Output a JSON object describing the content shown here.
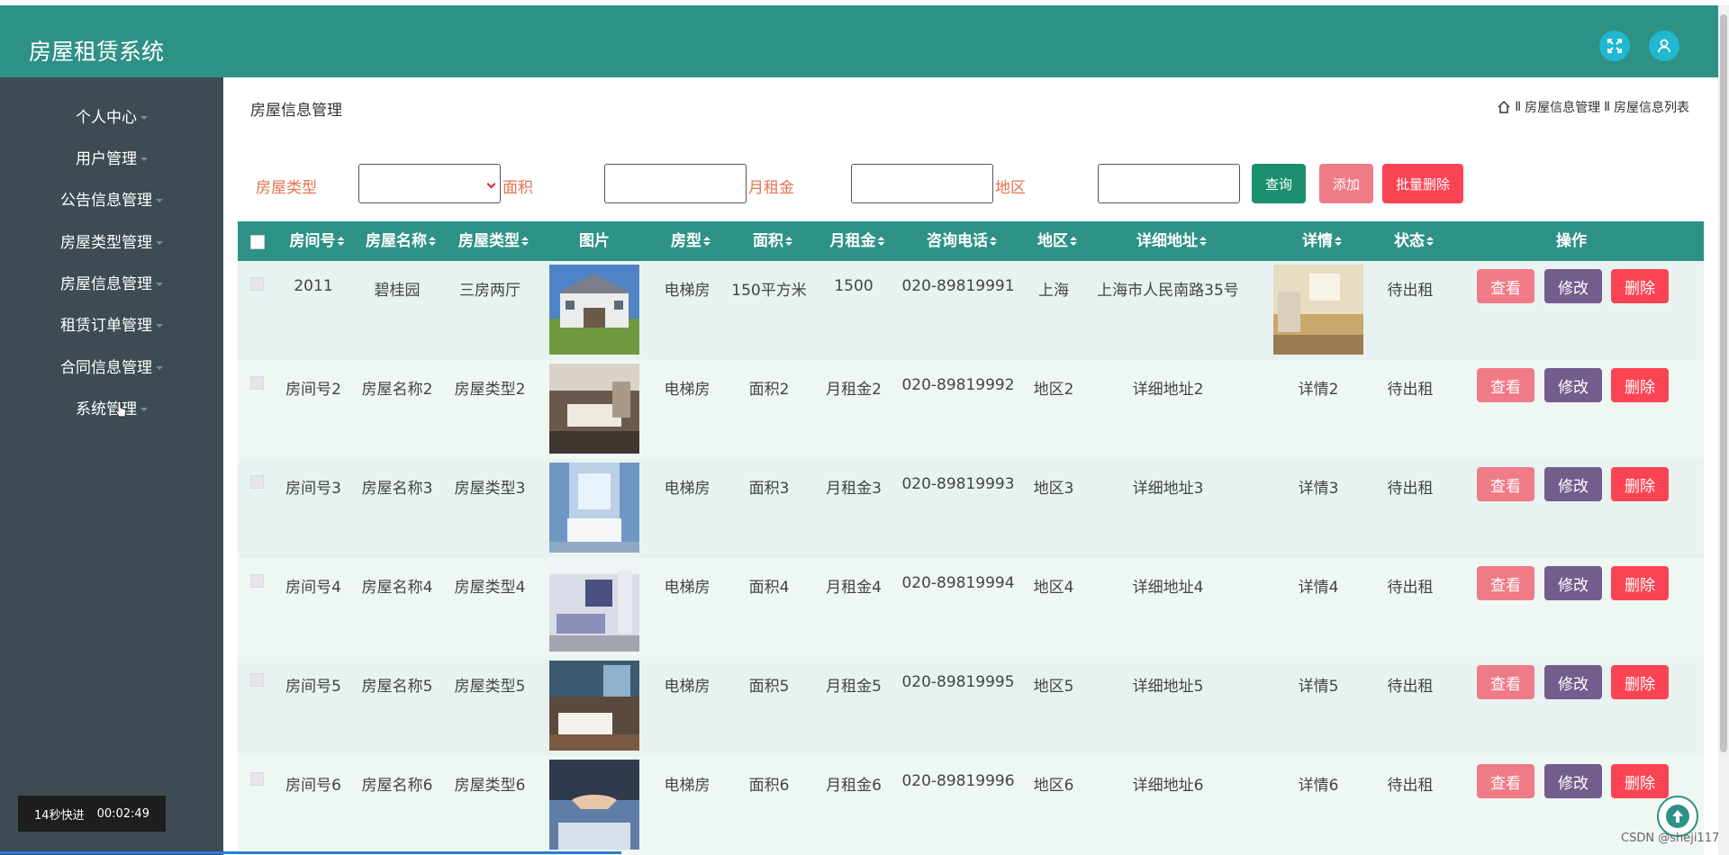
{
  "app": {
    "title": "房屋租赁系统"
  },
  "sidebar": {
    "items": [
      {
        "label": "个人中心"
      },
      {
        "label": "用户管理"
      },
      {
        "label": "公告信息管理"
      },
      {
        "label": "房屋类型管理"
      },
      {
        "label": "房屋信息管理"
      },
      {
        "label": "租赁订单管理"
      },
      {
        "label": "合同信息管理"
      },
      {
        "label": "系统管理"
      }
    ]
  },
  "video": {
    "speed_label": "14秒快进",
    "time": "00:02:49"
  },
  "page": {
    "title": "房屋信息管理",
    "breadcrumb": [
      "房屋信息管理",
      "房屋信息列表"
    ]
  },
  "search": {
    "house_type_label": "房屋类型",
    "area_label": "面积",
    "rent_label": "月租金",
    "region_label": "地区",
    "query_label": "查询",
    "add_label": "添加",
    "batch_delete_label": "批量删除"
  },
  "table": {
    "headers": [
      "房间号",
      "房屋名称",
      "房屋类型",
      "图片",
      "房型",
      "面积",
      "月租金",
      "咨询电话",
      "地区",
      "详细地址",
      "详情",
      "状态",
      "操作"
    ],
    "actions": {
      "view": "查看",
      "edit": "修改",
      "delete": "删除"
    },
    "rows": [
      {
        "room_no": "2011",
        "name": "碧桂园",
        "type": "三房两厅",
        "layout": "电梯房",
        "area": "150平方米",
        "rent": "1500",
        "phone": "020-89819991",
        "region": "上海",
        "address": "上海市人民南路35号",
        "detail": "",
        "status": "待出租"
      },
      {
        "room_no": "房间号2",
        "name": "房屋名称2",
        "type": "房屋类型2",
        "layout": "电梯房",
        "area": "面积2",
        "rent": "月租金2",
        "phone": "020-89819992",
        "region": "地区2",
        "address": "详细地址2",
        "detail": "详情2",
        "status": "待出租"
      },
      {
        "room_no": "房间号3",
        "name": "房屋名称3",
        "type": "房屋类型3",
        "layout": "电梯房",
        "area": "面积3",
        "rent": "月租金3",
        "phone": "020-89819993",
        "region": "地区3",
        "address": "详细地址3",
        "detail": "详情3",
        "status": "待出租"
      },
      {
        "room_no": "房间号4",
        "name": "房屋名称4",
        "type": "房屋类型4",
        "layout": "电梯房",
        "area": "面积4",
        "rent": "月租金4",
        "phone": "020-89819994",
        "region": "地区4",
        "address": "详细地址4",
        "detail": "详情4",
        "status": "待出租"
      },
      {
        "room_no": "房间号5",
        "name": "房屋名称5",
        "type": "房屋类型5",
        "layout": "电梯房",
        "area": "面积5",
        "rent": "月租金5",
        "phone": "020-89819995",
        "region": "地区5",
        "address": "详细地址5",
        "detail": "详情5",
        "status": "待出租"
      },
      {
        "room_no": "房间号6",
        "name": "房屋名称6",
        "type": "房屋类型6",
        "layout": "电梯房",
        "area": "面积6",
        "rent": "月租金6",
        "phone": "020-89819996",
        "region": "地区6",
        "address": "详细地址6",
        "detail": "详情6",
        "status": "待出租"
      }
    ]
  },
  "watermark": "CSDN @sheji117",
  "colors": {
    "primary": "#2e9185",
    "sidebar": "#3d4c52",
    "query": "#1b8f6f",
    "add": "#ef7b87",
    "edit": "#735d8d",
    "delete": "#fb4453"
  },
  "icons": [
    "fullscreen-icon",
    "user-icon",
    "home-icon",
    "back-to-top-icon"
  ]
}
